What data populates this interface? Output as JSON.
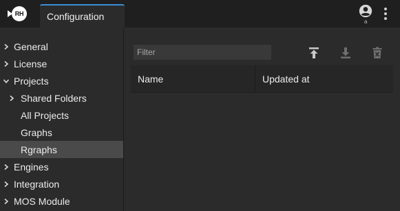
{
  "header": {
    "logo_text": "RH",
    "tab_label": "Configuration",
    "account_label": "a"
  },
  "sidebar": {
    "items": [
      {
        "label": "General",
        "expandable": true,
        "expanded": false,
        "level": 0
      },
      {
        "label": "License",
        "expandable": true,
        "expanded": false,
        "level": 0
      },
      {
        "label": "Projects",
        "expandable": true,
        "expanded": true,
        "level": 0
      },
      {
        "label": "Shared Folders",
        "expandable": true,
        "expanded": false,
        "level": 1
      },
      {
        "label": "All Projects",
        "expandable": false,
        "level": 1
      },
      {
        "label": "Graphs",
        "expandable": false,
        "level": 1
      },
      {
        "label": "Rgraphs",
        "expandable": false,
        "level": 1,
        "selected": true
      },
      {
        "label": "Engines",
        "expandable": true,
        "expanded": false,
        "level": 0
      },
      {
        "label": "Integration",
        "expandable": true,
        "expanded": false,
        "level": 0
      },
      {
        "label": "MOS Module",
        "expandable": true,
        "expanded": false,
        "level": 0
      }
    ]
  },
  "main": {
    "filter_placeholder": "Filter",
    "toolbar": {
      "upload_icon": "upload-icon",
      "download_icon": "download-icon",
      "delete_icon": "delete-icon"
    },
    "table": {
      "columns": [
        "Name",
        "Updated at"
      ],
      "rows": []
    }
  },
  "colors": {
    "topbar": "#1f1f1f",
    "background": "#2b2b2b",
    "tab_accent": "#3d8fd6",
    "selected_item": "#4a4a4a",
    "filter_bg": "#393939"
  }
}
